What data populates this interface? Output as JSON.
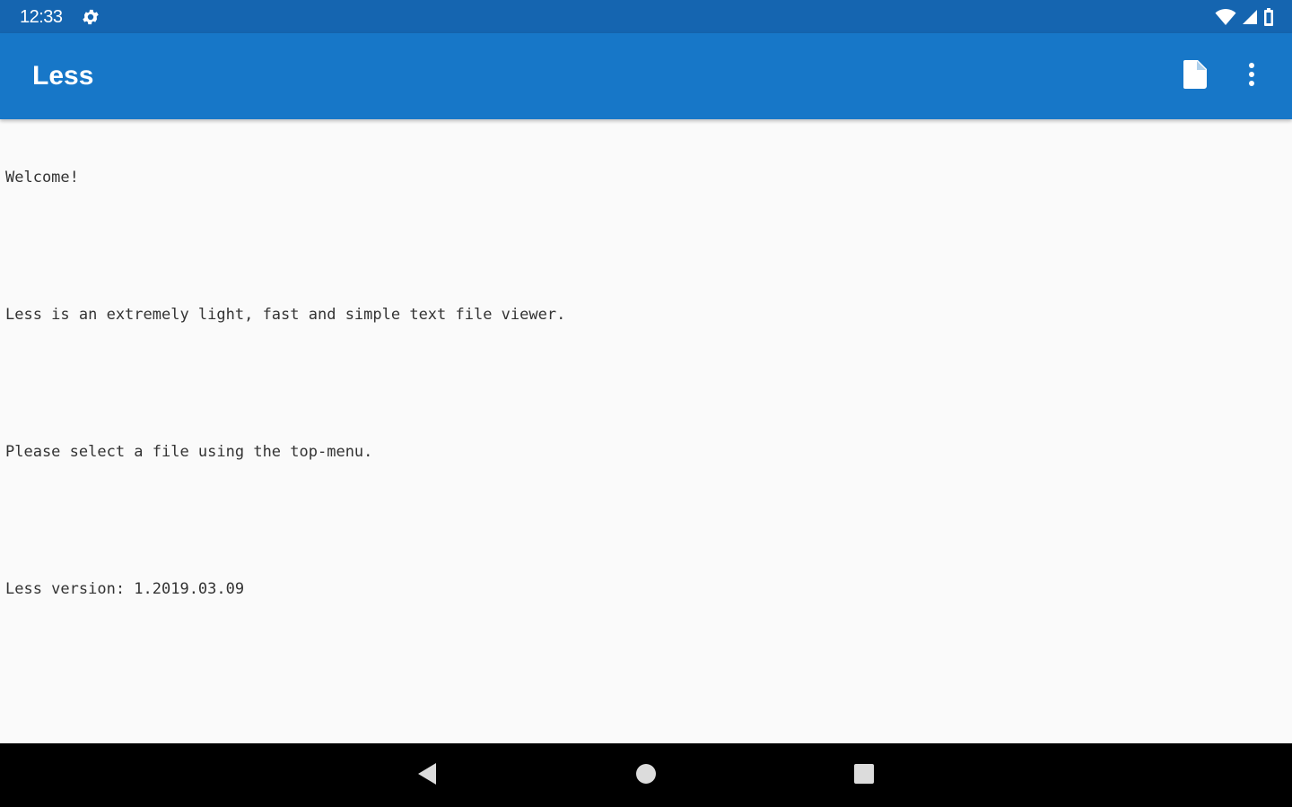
{
  "status_bar": {
    "time": "12:33",
    "icons": [
      "settings-gear-icon",
      "wifi-icon",
      "cell-signal-icon",
      "battery-icon"
    ]
  },
  "app_bar": {
    "title": "Less",
    "actions": [
      {
        "name": "open-file",
        "icon": "file-icon"
      },
      {
        "name": "overflow-menu",
        "icon": "more-vert-icon"
      }
    ]
  },
  "content": {
    "lines": [
      "Welcome!",
      "",
      "Less is an extremely light, fast and simple text file viewer.",
      "",
      "Please select a file using the top-menu.",
      "",
      "Less version: 1.2019.03.09"
    ]
  },
  "nav_bar": {
    "buttons": [
      {
        "name": "back",
        "icon": "back-triangle-icon"
      },
      {
        "name": "home",
        "icon": "home-circle-icon"
      },
      {
        "name": "recents",
        "icon": "recents-square-icon"
      }
    ]
  },
  "colors": {
    "status_bar": "#1565b0",
    "app_bar": "#1777c8",
    "content_bg": "#fafafa",
    "text": "#333333",
    "nav_bar": "#000000"
  }
}
